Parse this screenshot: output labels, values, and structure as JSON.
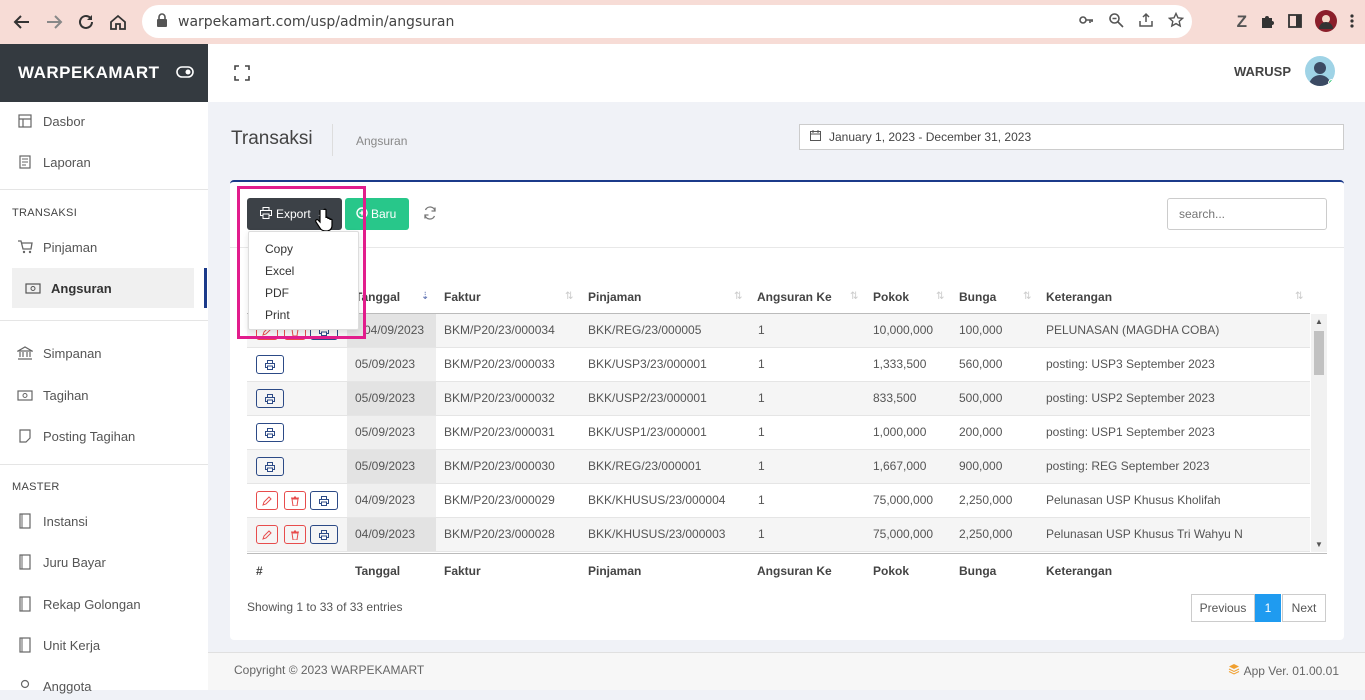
{
  "browser": {
    "url": "warpekamart.com/usp/admin/angsuran"
  },
  "sidebar": {
    "brand": "WARPEKAMART",
    "items_top": [
      {
        "label": "Dasbor",
        "icon": "dashboard-icon"
      },
      {
        "label": "Laporan",
        "icon": "report-icon"
      }
    ],
    "section_transaksi": "TRANSAKSI",
    "transaksi_items": [
      {
        "label": "Pinjaman",
        "icon": "cart-icon"
      },
      {
        "label": "Angsuran",
        "icon": "money-icon",
        "active": true
      }
    ],
    "items_mid": [
      {
        "label": "Simpanan",
        "icon": "bank-icon"
      },
      {
        "label": "Tagihan",
        "icon": "money-icon"
      },
      {
        "label": "Posting Tagihan",
        "icon": "note-icon"
      }
    ],
    "section_master": "MASTER",
    "master_items": [
      {
        "label": "Instansi"
      },
      {
        "label": "Juru Bayar"
      },
      {
        "label": "Rekap Golongan"
      },
      {
        "label": "Unit Kerja"
      },
      {
        "label": "Anggota"
      }
    ]
  },
  "topbar": {
    "username": "WARUSP"
  },
  "page": {
    "title": "Transaksi",
    "breadcrumb": "Angsuran",
    "date_range": "January 1, 2023 - December 31, 2023"
  },
  "toolbar": {
    "export_label": "Export",
    "new_label": "Baru",
    "search_placeholder": "search..."
  },
  "export_menu": [
    "Copy",
    "Excel",
    "PDF",
    "Print"
  ],
  "table": {
    "columns": [
      "#",
      "Tanggal",
      "Faktur",
      "Pinjaman",
      "Angsuran Ke",
      "Pokok",
      "Bunga",
      "Keterangan"
    ],
    "rows": [
      {
        "actions": [
          "edit",
          "delete",
          "print"
        ],
        "tanggal": "04/09/2023",
        "faktur": "BKM/P20/23/000034",
        "pinjaman": "BKK/REG/23/000005",
        "ke": "1",
        "pokok": "10,000,000",
        "bunga": "100,000",
        "keterangan": "PELUNASAN (MAGDHA COBA)"
      },
      {
        "actions": [
          "print"
        ],
        "tanggal": "05/09/2023",
        "faktur": "BKM/P20/23/000033",
        "pinjaman": "BKK/USP3/23/000001",
        "ke": "1",
        "pokok": "1,333,500",
        "bunga": "560,000",
        "keterangan": "posting: USP3 September 2023"
      },
      {
        "actions": [
          "print"
        ],
        "tanggal": "05/09/2023",
        "faktur": "BKM/P20/23/000032",
        "pinjaman": "BKK/USP2/23/000001",
        "ke": "1",
        "pokok": "833,500",
        "bunga": "500,000",
        "keterangan": "posting: USP2 September 2023"
      },
      {
        "actions": [
          "print"
        ],
        "tanggal": "05/09/2023",
        "faktur": "BKM/P20/23/000031",
        "pinjaman": "BKK/USP1/23/000001",
        "ke": "1",
        "pokok": "1,000,000",
        "bunga": "200,000",
        "keterangan": "posting: USP1 September 2023"
      },
      {
        "actions": [
          "print"
        ],
        "tanggal": "05/09/2023",
        "faktur": "BKM/P20/23/000030",
        "pinjaman": "BKK/REG/23/000001",
        "ke": "1",
        "pokok": "1,667,000",
        "bunga": "900,000",
        "keterangan": "posting: REG September 2023"
      },
      {
        "actions": [
          "edit",
          "delete",
          "print"
        ],
        "tanggal": "04/09/2023",
        "faktur": "BKM/P20/23/000029",
        "pinjaman": "BKK/KHUSUS/23/000004",
        "ke": "1",
        "pokok": "75,000,000",
        "bunga": "2,250,000",
        "keterangan": "Pelunasan USP Khusus Kholifah"
      },
      {
        "actions": [
          "edit",
          "delete",
          "print"
        ],
        "tanggal": "04/09/2023",
        "faktur": "BKM/P20/23/000028",
        "pinjaman": "BKK/KHUSUS/23/000003",
        "ke": "1",
        "pokok": "75,000,000",
        "bunga": "2,250,000",
        "keterangan": "Pelunasan USP Khusus Tri Wahyu N"
      }
    ]
  },
  "pagination": {
    "info": "Showing 1 to 33 of 33 entries",
    "previous": "Previous",
    "current": "1",
    "next": "Next"
  },
  "footer": {
    "copyright": "Copyright © 2023 WARPEKAMART",
    "version": "App Ver. 01.00.01"
  }
}
